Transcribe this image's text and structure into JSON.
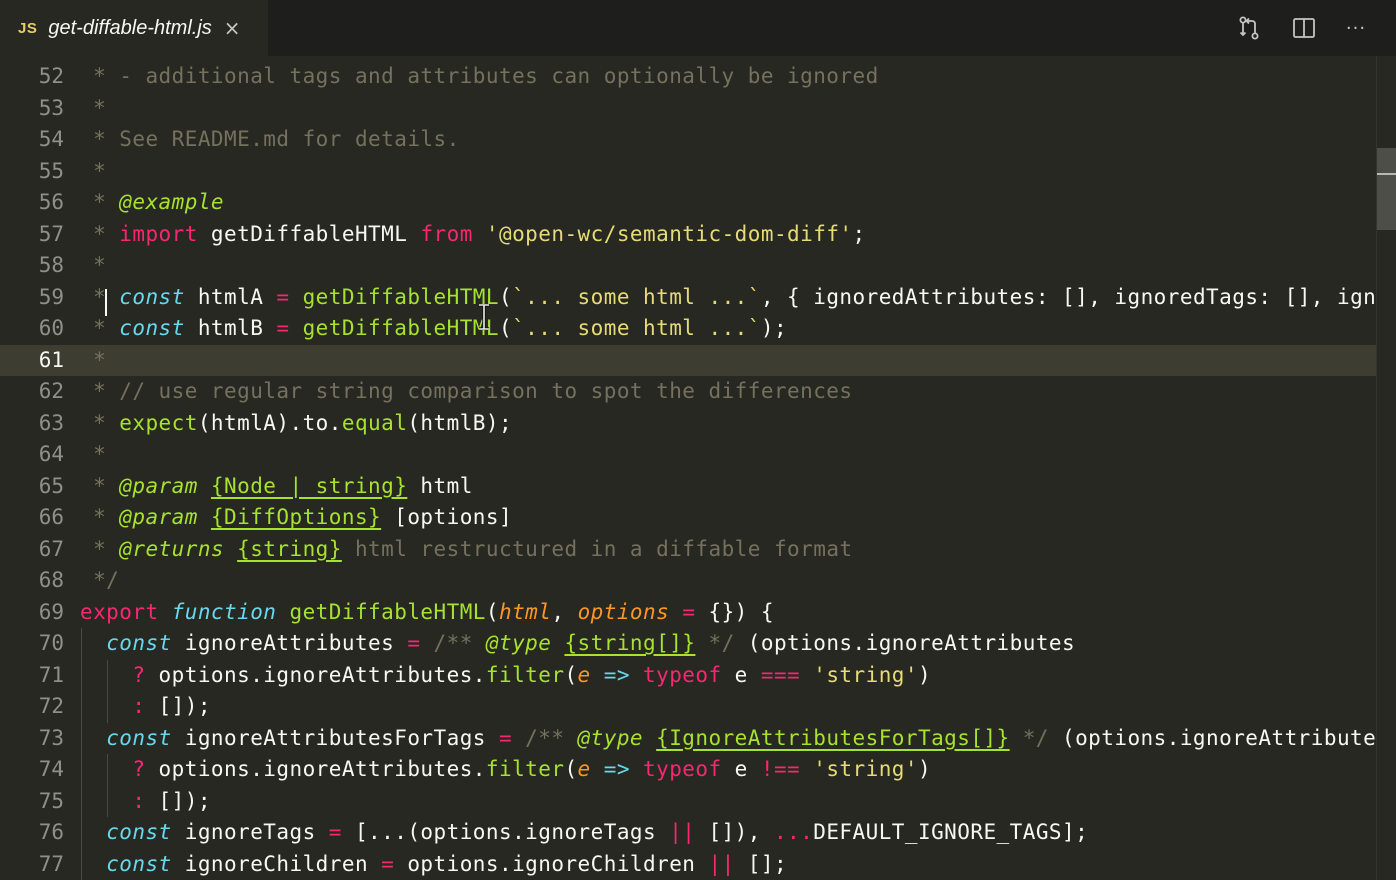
{
  "tab": {
    "lang_badge": "JS",
    "filename": "get-diffable-html.js",
    "close_glyph": "×"
  },
  "toolbar": {
    "compare_icon": "git-compare-icon",
    "split_icon": "split-editor-icon",
    "more_label": "···"
  },
  "editor": {
    "current_line": 61,
    "lines": [
      {
        "n": "52",
        "tokens": [
          [
            "c",
            " * - additional tags and attributes can optionally be ignored"
          ]
        ]
      },
      {
        "n": "53",
        "tokens": [
          [
            "c",
            " *"
          ]
        ]
      },
      {
        "n": "54",
        "tokens": [
          [
            "c",
            " * See README.md for details."
          ]
        ]
      },
      {
        "n": "55",
        "tokens": [
          [
            "c",
            " *"
          ]
        ]
      },
      {
        "n": "56",
        "tokens": [
          [
            "c",
            " * "
          ],
          [
            "tg",
            "@example"
          ]
        ]
      },
      {
        "n": "57",
        "tokens": [
          [
            "c",
            " * "
          ],
          [
            "k",
            "import"
          ],
          [
            "w",
            " getDiffableHTML "
          ],
          [
            "k",
            "from"
          ],
          [
            "w",
            " "
          ],
          [
            "s",
            "'@open-wc/semantic-dom-diff'"
          ],
          [
            "w",
            ";"
          ]
        ]
      },
      {
        "n": "58",
        "tokens": [
          [
            "c",
            " *"
          ]
        ]
      },
      {
        "n": "59",
        "tokens": [
          [
            "c",
            " * "
          ],
          [
            "i",
            "const"
          ],
          [
            "w",
            " htmlA "
          ],
          [
            "k",
            "="
          ],
          [
            "w",
            " "
          ],
          [
            "f",
            "getDiffableHTML"
          ],
          [
            "w",
            "("
          ],
          [
            "s",
            "`... some html ...`"
          ],
          [
            "w",
            ", { ignoredAttributes: [], ignoredTags: [], ignoreChildren: [] });"
          ]
        ]
      },
      {
        "n": "60",
        "tokens": [
          [
            "c",
            " * "
          ],
          [
            "i",
            "const"
          ],
          [
            "w",
            " htmlB "
          ],
          [
            "k",
            "="
          ],
          [
            "w",
            " "
          ],
          [
            "f",
            "getDiffableHTML"
          ],
          [
            "w",
            "("
          ],
          [
            "s",
            "`... some html ...`"
          ],
          [
            "w",
            ");"
          ]
        ]
      },
      {
        "n": "61",
        "tokens": [
          [
            "c",
            " *"
          ]
        ]
      },
      {
        "n": "62",
        "tokens": [
          [
            "c",
            " * // use regular string comparison to spot the differences"
          ]
        ]
      },
      {
        "n": "63",
        "tokens": [
          [
            "c",
            " * "
          ],
          [
            "f",
            "expect"
          ],
          [
            "w",
            "(htmlA).to."
          ],
          [
            "f",
            "equal"
          ],
          [
            "w",
            "(htmlB);"
          ]
        ]
      },
      {
        "n": "64",
        "tokens": [
          [
            "c",
            " *"
          ]
        ]
      },
      {
        "n": "65",
        "tokens": [
          [
            "c",
            " * "
          ],
          [
            "tg",
            "@param"
          ],
          [
            "w",
            " "
          ],
          [
            "fu",
            "{Node | string}"
          ],
          [
            "w",
            " html"
          ]
        ]
      },
      {
        "n": "66",
        "tokens": [
          [
            "c",
            " * "
          ],
          [
            "tg",
            "@param"
          ],
          [
            "w",
            " "
          ],
          [
            "fu",
            "{DiffOptions}"
          ],
          [
            "w",
            " [options]"
          ]
        ]
      },
      {
        "n": "67",
        "tokens": [
          [
            "c",
            " * "
          ],
          [
            "tg",
            "@returns"
          ],
          [
            "w",
            " "
          ],
          [
            "fu",
            "{string}"
          ],
          [
            "c",
            " html restructured in a diffable format"
          ]
        ]
      },
      {
        "n": "68",
        "tokens": [
          [
            "c",
            " */"
          ]
        ]
      },
      {
        "n": "69",
        "tokens": [
          [
            "k",
            "export"
          ],
          [
            "w",
            " "
          ],
          [
            "i",
            "function"
          ],
          [
            "w",
            " "
          ],
          [
            "f",
            "getDiffableHTML"
          ],
          [
            "w",
            "("
          ],
          [
            "p",
            "html"
          ],
          [
            "w",
            ", "
          ],
          [
            "p",
            "options"
          ],
          [
            "w",
            " "
          ],
          [
            "k",
            "="
          ],
          [
            "w",
            " {}) {"
          ]
        ]
      },
      {
        "n": "70",
        "tokens": [
          [
            "w",
            "  "
          ],
          [
            "i",
            "const"
          ],
          [
            "w",
            " ignoreAttributes "
          ],
          [
            "k",
            "="
          ],
          [
            "w",
            " "
          ],
          [
            "c",
            "/** "
          ],
          [
            "tg",
            "@type"
          ],
          [
            "w",
            " "
          ],
          [
            "fu",
            "{string[]}"
          ],
          [
            "c",
            " */"
          ],
          [
            "w",
            " (options.ignoreAttributes"
          ]
        ]
      },
      {
        "n": "71",
        "tokens": [
          [
            "w",
            "    "
          ],
          [
            "k",
            "?"
          ],
          [
            "w",
            " options.ignoreAttributes."
          ],
          [
            "f",
            "filter"
          ],
          [
            "w",
            "("
          ],
          [
            "p",
            "e"
          ],
          [
            "w",
            " "
          ],
          [
            "i",
            "=>"
          ],
          [
            "w",
            " "
          ],
          [
            "k",
            "typeof"
          ],
          [
            "w",
            " e "
          ],
          [
            "k",
            "==="
          ],
          [
            "w",
            " "
          ],
          [
            "s",
            "'string'"
          ],
          [
            "w",
            ")"
          ]
        ]
      },
      {
        "n": "72",
        "tokens": [
          [
            "w",
            "    "
          ],
          [
            "k",
            ":"
          ],
          [
            "w",
            " []);"
          ]
        ]
      },
      {
        "n": "73",
        "tokens": [
          [
            "w",
            "  "
          ],
          [
            "i",
            "const"
          ],
          [
            "w",
            " ignoreAttributesForTags "
          ],
          [
            "k",
            "="
          ],
          [
            "w",
            " "
          ],
          [
            "c",
            "/** "
          ],
          [
            "tg",
            "@type"
          ],
          [
            "w",
            " "
          ],
          [
            "fu",
            "{IgnoreAttributesForTags[]}"
          ],
          [
            "c",
            " */"
          ],
          [
            "w",
            " (options.ignoreAttributes"
          ]
        ]
      },
      {
        "n": "74",
        "tokens": [
          [
            "w",
            "    "
          ],
          [
            "k",
            "?"
          ],
          [
            "w",
            " options.ignoreAttributes."
          ],
          [
            "f",
            "filter"
          ],
          [
            "w",
            "("
          ],
          [
            "p",
            "e"
          ],
          [
            "w",
            " "
          ],
          [
            "i",
            "=>"
          ],
          [
            "w",
            " "
          ],
          [
            "k",
            "typeof"
          ],
          [
            "w",
            " e "
          ],
          [
            "k",
            "!=="
          ],
          [
            "w",
            " "
          ],
          [
            "s",
            "'string'"
          ],
          [
            "w",
            ")"
          ]
        ]
      },
      {
        "n": "75",
        "tokens": [
          [
            "w",
            "    "
          ],
          [
            "k",
            ":"
          ],
          [
            "w",
            " []);"
          ]
        ]
      },
      {
        "n": "76",
        "tokens": [
          [
            "w",
            "  "
          ],
          [
            "i",
            "const"
          ],
          [
            "w",
            " ignoreTags "
          ],
          [
            "k",
            "="
          ],
          [
            "w",
            " [...(options.ignoreTags "
          ],
          [
            "k",
            "||"
          ],
          [
            "w",
            " []), "
          ],
          [
            "k",
            "..."
          ],
          [
            "w",
            "DEFAULT_IGNORE_TAGS];"
          ]
        ]
      },
      {
        "n": "77",
        "tokens": [
          [
            "w",
            "  "
          ],
          [
            "i",
            "const"
          ],
          [
            "w",
            " ignoreChildren "
          ],
          [
            "k",
            "="
          ],
          [
            "w",
            " options.ignoreChildren "
          ],
          [
            "k",
            "||"
          ],
          [
            "w",
            " [];"
          ]
        ]
      }
    ]
  },
  "colors": {
    "background": "#272822",
    "tabbar": "#1e1f1c",
    "comment": "#75715e",
    "keyword": "#f92672",
    "string": "#e6db74",
    "function": "#a6e22e",
    "storage": "#66d9ef",
    "parameter": "#fd971f"
  }
}
